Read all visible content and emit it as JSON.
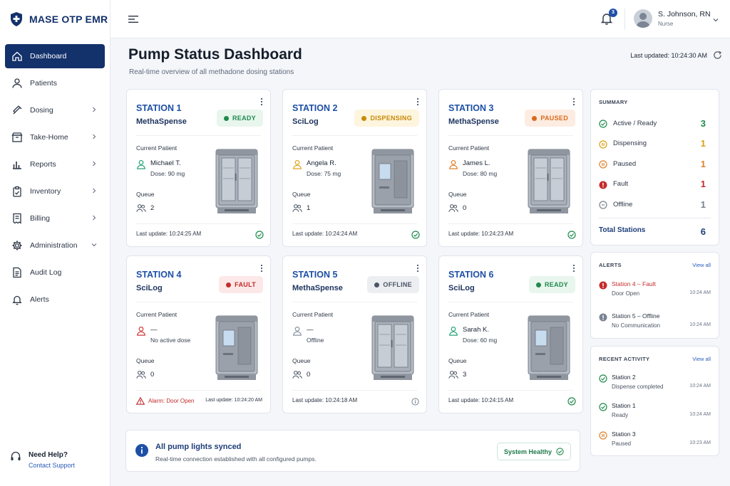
{
  "app": {
    "name": "MASE OTP EMR"
  },
  "sidebar": {
    "items": [
      {
        "label": "Dashboard",
        "icon": "home-icon",
        "active": true
      },
      {
        "label": "Patients",
        "icon": "person-icon"
      },
      {
        "label": "Dosing",
        "icon": "syringe-icon",
        "chevron": "right"
      },
      {
        "label": "Take-Home",
        "icon": "box-icon",
        "chevron": "right"
      },
      {
        "label": "Reports",
        "icon": "bar-chart-icon",
        "chevron": "right"
      },
      {
        "label": "Inventory",
        "icon": "clipboard-icon",
        "chevron": "right"
      },
      {
        "label": "Billing",
        "icon": "receipt-icon",
        "chevron": "right"
      },
      {
        "label": "Administration",
        "icon": "gear-icon",
        "chevron": "down"
      },
      {
        "label": "Audit Log",
        "icon": "document-icon"
      },
      {
        "label": "Alerts",
        "icon": "bell-icon"
      }
    ],
    "help": {
      "title": "Need Help?",
      "link": "Contact Support"
    }
  },
  "topbar": {
    "notification_count": "3",
    "user": {
      "name": "S. Johnson, RN",
      "role": "Nurse"
    }
  },
  "page": {
    "title": "Pump Status Dashboard",
    "subtitle": "Real-time overview of all methadone dosing stations",
    "last_updated": "Last updated: 10:24:30 AM"
  },
  "labels": {
    "current_patient": "Current Patient",
    "queue": "Queue"
  },
  "stations": [
    {
      "name": "STATION 1",
      "brand": "MethaSpense",
      "status": "READY",
      "status_color": "#1f8a4c",
      "status_bg": "#e8f6ee",
      "patient": "Michael T.",
      "dose": "Dose: 90 mg",
      "patient_color": "#27a37a",
      "queue": "2",
      "last_update": "Last update: 10:24:25 AM",
      "foot_icon": "check-circle-icon",
      "foot_color": "#1f8a4c"
    },
    {
      "name": "STATION 2",
      "brand": "SciLog",
      "status": "DISPENSING",
      "status_color": "#c98a07",
      "status_bg": "#fdf5de",
      "patient": "Angela R.",
      "dose": "Dose: 75 mg",
      "patient_color": "#e0a51c",
      "queue": "1",
      "last_update": "Last update: 10:24:24 AM",
      "foot_icon": "check-circle-icon",
      "foot_color": "#1f8a4c"
    },
    {
      "name": "STATION 3",
      "brand": "MethaSpense",
      "status": "PAUSED",
      "status_color": "#d86a1c",
      "status_bg": "#fdece2",
      "patient": "James L.",
      "dose": "Dose: 80 mg",
      "patient_color": "#e0812c",
      "queue": "0",
      "last_update": "Last update: 10:24:23 AM",
      "foot_icon": "check-circle-icon",
      "foot_color": "#1f8a4c"
    },
    {
      "name": "STATION 4",
      "brand": "SciLog",
      "status": "FAULT",
      "status_color": "#c42b2b",
      "status_bg": "#fce8e8",
      "patient": "—",
      "dose": "No active dose",
      "patient_color": "#d23a3a",
      "queue": "0",
      "last_update": "Last update: 10:24:20 AM",
      "alarm": "Alarm: Door Open",
      "foot_icon": "warning-triangle-icon",
      "foot_color": "#c42b2b"
    },
    {
      "name": "STATION 5",
      "brand": "MethaSpense",
      "status": "OFFLINE",
      "status_color": "#4b5565",
      "status_bg": "#eceef2",
      "patient": "—",
      "dose": "Offline",
      "patient_color": "#8a93a1",
      "queue": "0",
      "last_update": "Last update: 10:24:18 AM",
      "foot_icon": "info-icon",
      "foot_color": "#7a8392"
    },
    {
      "name": "STATION 6",
      "brand": "SciLog",
      "status": "READY",
      "status_color": "#1f8a4c",
      "status_bg": "#e8f6ee",
      "patient": "Sarah K.",
      "dose": "Dose: 60 mg",
      "patient_color": "#27a37a",
      "queue": "3",
      "last_update": "Last update: 10:24:15 AM",
      "foot_icon": "check-circle-icon",
      "foot_color": "#1f8a4c"
    }
  ],
  "summary": {
    "title": "SUMMARY",
    "rows": [
      {
        "label": "Active / Ready",
        "value": "3",
        "color": "#1f8a4c",
        "icon": "check-circle-icon"
      },
      {
        "label": "Dispensing",
        "value": "1",
        "color": "#d9a115",
        "icon": "pause-circle-icon"
      },
      {
        "label": "Paused",
        "value": "1",
        "color": "#e0812c",
        "icon": "pause-circle-icon"
      },
      {
        "label": "Fault",
        "value": "1",
        "color": "#c42b2b",
        "icon": "alert-circle-icon"
      },
      {
        "label": "Offline",
        "value": "1",
        "color": "#7a8392",
        "icon": "minus-circle-icon"
      }
    ],
    "total_label": "Total Stations",
    "total_value": "6"
  },
  "alerts": {
    "title": "ALERTS",
    "link": "View all",
    "items": [
      {
        "title": "Station 4 – Fault",
        "sub": "Door Open",
        "time": "10:24 AM",
        "color": "#c42b2b",
        "icon": "alert-circle-icon"
      },
      {
        "title": "Station 5 – Offline",
        "sub": "No Communication",
        "time": "10:24 AM",
        "color": "#7a8392",
        "icon": "alert-circle-icon"
      }
    ]
  },
  "activity": {
    "title": "RECENT ACTIVITY",
    "link": "View all",
    "items": [
      {
        "title": "Station 2",
        "sub": "Dispense completed",
        "time": "10:24 AM",
        "color": "#1f8a4c",
        "icon": "check-circle-icon"
      },
      {
        "title": "Station 1",
        "sub": "Ready",
        "time": "10:24 AM",
        "color": "#1f8a4c",
        "icon": "check-circle-icon"
      },
      {
        "title": "Station 3",
        "sub": "Paused",
        "time": "10:23 AM",
        "color": "#e0812c",
        "icon": "pause-circle-icon"
      }
    ]
  },
  "banner": {
    "title": "All pump lights synced",
    "sub": "Real-time connection established with all configured pumps.",
    "button": "System Healthy"
  },
  "colors": {
    "primary": "#13316b",
    "link": "#1d4fa6"
  }
}
